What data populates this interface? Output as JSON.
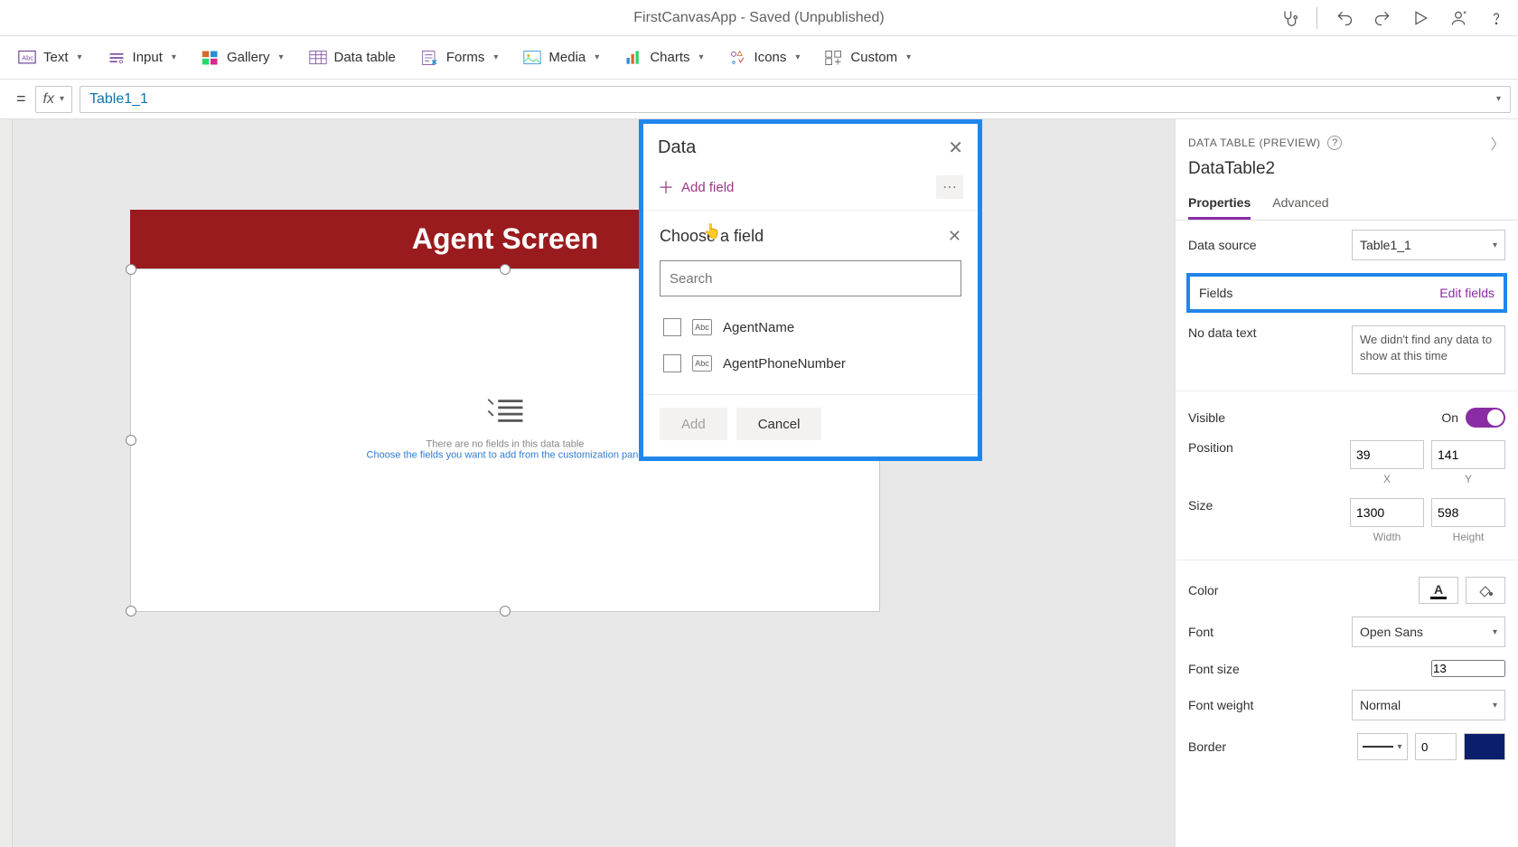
{
  "titleBar": {
    "appTitle": "FirstCanvasApp - Saved (Unpublished)"
  },
  "ribbon": {
    "text": "Text",
    "input": "Input",
    "gallery": "Gallery",
    "dataTable": "Data table",
    "forms": "Forms",
    "media": "Media",
    "charts": "Charts",
    "icons": "Icons",
    "custom": "Custom"
  },
  "formula": {
    "eq": "=",
    "fx": "fx",
    "value": "Table1_1"
  },
  "canvas": {
    "screenTitle": "Agent Screen",
    "emptyLine1": "There are no fields in this data table",
    "emptyLine2": "Choose the fields you want to add from the customization pane"
  },
  "dataPanel": {
    "title": "Data",
    "addField": "Add field",
    "chooseTitle": "Choose a field",
    "searchPlaceholder": "Search",
    "fields": [
      {
        "type": "Abc",
        "name": "AgentName"
      },
      {
        "type": "Abc",
        "name": "AgentPhoneNumber"
      }
    ],
    "addBtn": "Add",
    "cancelBtn": "Cancel"
  },
  "rightPanel": {
    "header": "DATA TABLE (PREVIEW)",
    "controlName": "DataTable2",
    "tabs": {
      "properties": "Properties",
      "advanced": "Advanced"
    },
    "dataSourceLabel": "Data source",
    "dataSourceValue": "Table1_1",
    "fieldsLabel": "Fields",
    "editFields": "Edit fields",
    "noDataLabel": "No data text",
    "noDataValue": "We didn't find any data to show at this time",
    "visibleLabel": "Visible",
    "visibleValue": "On",
    "positionLabel": "Position",
    "posX": "39",
    "posY": "141",
    "xLbl": "X",
    "yLbl": "Y",
    "sizeLabel": "Size",
    "width": "1300",
    "height": "598",
    "wLbl": "Width",
    "hLbl": "Height",
    "colorLabel": "Color",
    "fontLabel": "Font",
    "fontValue": "Open Sans",
    "fontSizeLabel": "Font size",
    "fontSizeValue": "13",
    "fontWeightLabel": "Font weight",
    "fontWeightValue": "Normal",
    "borderLabel": "Border",
    "borderWidth": "0"
  }
}
